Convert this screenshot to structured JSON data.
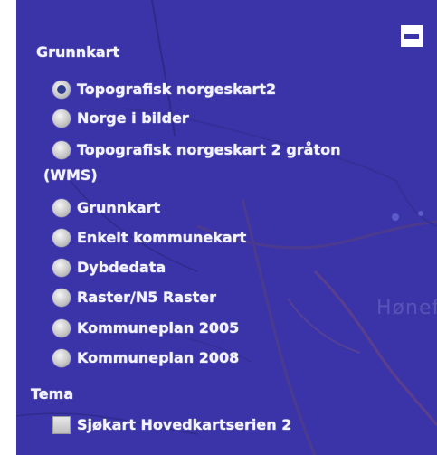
{
  "panel": {
    "background_color": "#3b34a8",
    "map_place_label": "Hønef",
    "collapse_icon": "minus-icon"
  },
  "groups": [
    {
      "heading": "Grunnkart",
      "layers": [
        {
          "label": "Topografisk norgeskart2",
          "selected": true
        },
        {
          "label": "Norge i bilder",
          "selected": false
        },
        {
          "label": "Topografisk norgeskart 2 gråton",
          "label_cont": "(WMS)",
          "selected": false
        },
        {
          "label": "Grunnkart",
          "selected": false
        },
        {
          "label": "Enkelt kommunekart",
          "selected": false
        },
        {
          "label": "Dybdedata",
          "selected": false
        },
        {
          "label": "Raster/N5 Raster",
          "selected": false
        },
        {
          "label": "Kommuneplan 2005",
          "selected": false
        },
        {
          "label": "Kommuneplan 2008",
          "selected": false
        }
      ]
    },
    {
      "heading": "Tema",
      "layers": [
        {
          "label": "Sjøkart Hovedkartserien 2",
          "checked": false
        }
      ]
    }
  ]
}
